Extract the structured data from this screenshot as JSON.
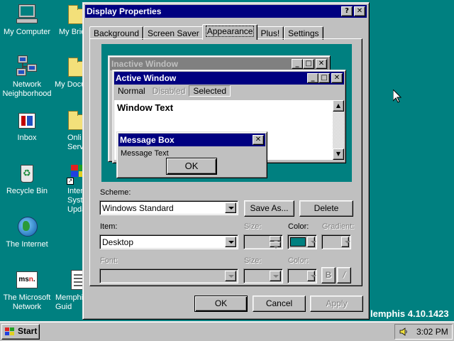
{
  "desktop": {
    "icons": [
      {
        "label": "My Computer"
      },
      {
        "label": "My Brie"
      },
      {
        "label": "Network Neighborhood"
      },
      {
        "label": "My Docu"
      },
      {
        "label": "Inbox"
      },
      {
        "label": "Onli Servi"
      },
      {
        "label": "Recycle Bin"
      },
      {
        "label": "Inter Syst Upda"
      },
      {
        "label": "The Internet"
      },
      {
        "label": "The Microsoft Network"
      },
      {
        "label": "Memphi Guid"
      }
    ],
    "version_text": "lemphis 4.10.1423",
    "background_color": "#008080"
  },
  "dialog": {
    "title": "Display Properties",
    "help_btn": "?",
    "close_btn": "✕",
    "tabs": [
      "Background",
      "Screen Saver",
      "Appearance",
      "Plus!",
      "Settings"
    ],
    "selected_tab": "Appearance",
    "preview": {
      "inactive_title": "Inactive Window",
      "active_title": "Active Window",
      "menu_normal": "Normal",
      "menu_disabled": "Disabled",
      "menu_selected": "Selected",
      "window_text": "Window Text",
      "msgbox_title": "Message Box",
      "msgbox_text": "Message Text",
      "msgbox_ok": "OK"
    },
    "scheme_label": "Scheme:",
    "scheme_value": "Windows Standard",
    "save_as_label": "Save As...",
    "delete_label": "Delete",
    "item_label": "Item:",
    "item_value": "Desktop",
    "size_label": "Size:",
    "color_label": "Color:",
    "color_value": "#008080",
    "gradient_label": "Gradient:",
    "font_label": "Font:",
    "font_size_label": "Size:",
    "font_color_label": "Color:",
    "bold_label": "B",
    "italic_label": "/",
    "ok_label": "OK",
    "cancel_label": "Cancel",
    "apply_label": "Apply"
  },
  "taskbar": {
    "start_label": "Start",
    "clock": "3:02 PM"
  }
}
